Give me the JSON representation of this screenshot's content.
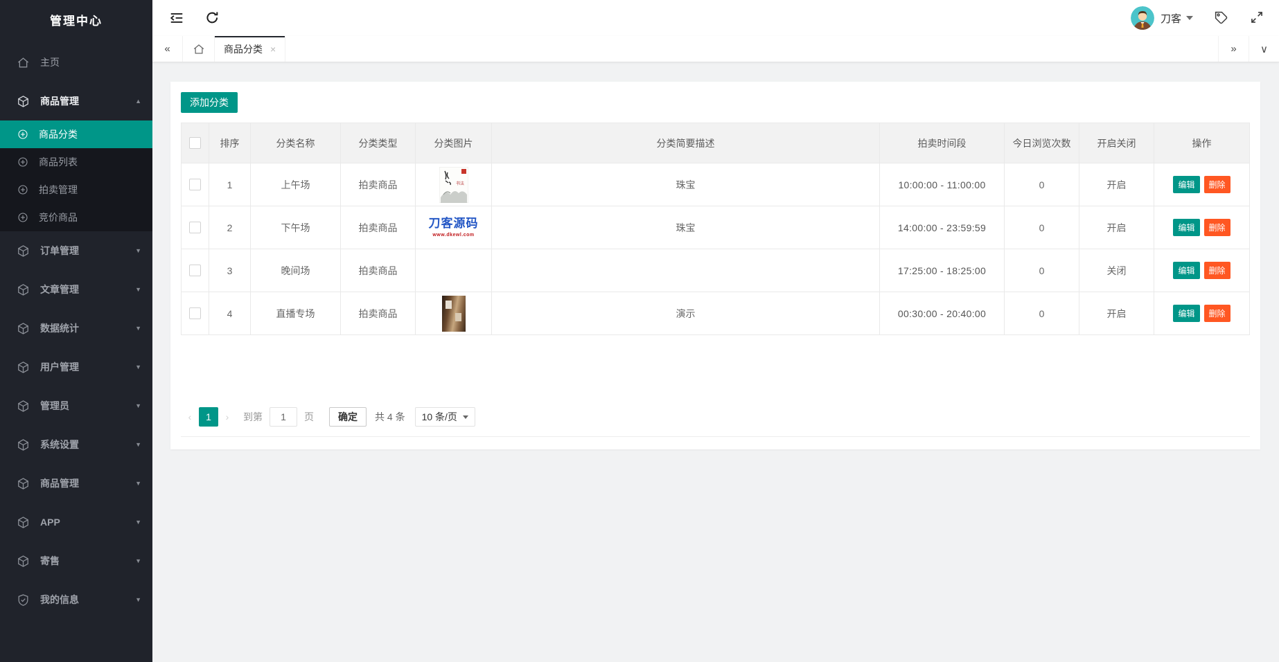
{
  "app": {
    "title": "管理中心"
  },
  "colors": {
    "primary": "#009688",
    "danger": "#FF5722",
    "sidebar_bg": "#20232b",
    "submenu_bg": "#15171d",
    "content_bg": "#f1f2f3"
  },
  "icons": {
    "tabs_prev": "«",
    "tabs_next": "»",
    "tabs_more": "∨",
    "tab_close": "×",
    "pager_prev": "‹",
    "pager_next": "›"
  },
  "sidebar": {
    "items": [
      {
        "label": "主页",
        "icon": "home-icon"
      },
      {
        "label": "商品管理",
        "icon": "cube-icon",
        "expanded": true,
        "children": [
          {
            "label": "商品分类",
            "active": true
          },
          {
            "label": "商品列表"
          },
          {
            "label": "拍卖管理"
          },
          {
            "label": "竞价商品"
          }
        ]
      },
      {
        "label": "订单管理",
        "icon": "cube-icon"
      },
      {
        "label": "文章管理",
        "icon": "cube-icon"
      },
      {
        "label": "数据统计",
        "icon": "cube-icon"
      },
      {
        "label": "用户管理",
        "icon": "cube-icon"
      },
      {
        "label": "管理员",
        "icon": "cube-icon"
      },
      {
        "label": "系统设置",
        "icon": "cube-icon"
      },
      {
        "label": "商品管理",
        "icon": "cube-icon"
      },
      {
        "label": "APP",
        "icon": "cube-icon"
      },
      {
        "label": "寄售",
        "icon": "cube-icon"
      },
      {
        "label": "我的信息",
        "icon": "shield-check-icon"
      }
    ]
  },
  "header": {
    "user": {
      "name": "刀客"
    }
  },
  "tabs": {
    "active_label": "商品分类"
  },
  "toolbar": {
    "add_label": "添加分类"
  },
  "table": {
    "columns": [
      "排序",
      "分类名称",
      "分类类型",
      "分类图片",
      "分类简要描述",
      "拍卖时间段",
      "今日浏览次数",
      "开启关闭",
      "操作"
    ],
    "actions": {
      "edit": "编辑",
      "delete": "删除"
    },
    "rows": [
      {
        "sort": "1",
        "name": "上午场",
        "type": "拍卖商品",
        "image": "ink-painting-thumbnail",
        "desc": "珠宝",
        "time": "10:00:00 - 11:00:00",
        "views": "0",
        "status": "开启"
      },
      {
        "sort": "2",
        "name": "下午场",
        "type": "拍卖商品",
        "image": "daoke-logo-thumbnail",
        "image_text": "刀客源码",
        "image_subtext": "www.dkewl.com",
        "desc": "珠宝",
        "time": "14:00:00 - 23:59:59",
        "views": "0",
        "status": "开启"
      },
      {
        "sort": "3",
        "name": "晚间场",
        "type": "拍卖商品",
        "image": "",
        "desc": "",
        "time": "17:25:00 - 18:25:00",
        "views": "0",
        "status": "关闭"
      },
      {
        "sort": "4",
        "name": "直播专场",
        "type": "拍卖商品",
        "image": "shop-photo-thumbnail",
        "desc": "演示",
        "time": "00:30:00 - 20:40:00",
        "views": "0",
        "status": "开启"
      }
    ]
  },
  "pagination": {
    "current": "1",
    "goto_label": "到第",
    "goto_value": "1",
    "page_label": "页",
    "confirm_label": "确定",
    "total_label": "共 4 条",
    "per_page_label": "10 条/页"
  }
}
